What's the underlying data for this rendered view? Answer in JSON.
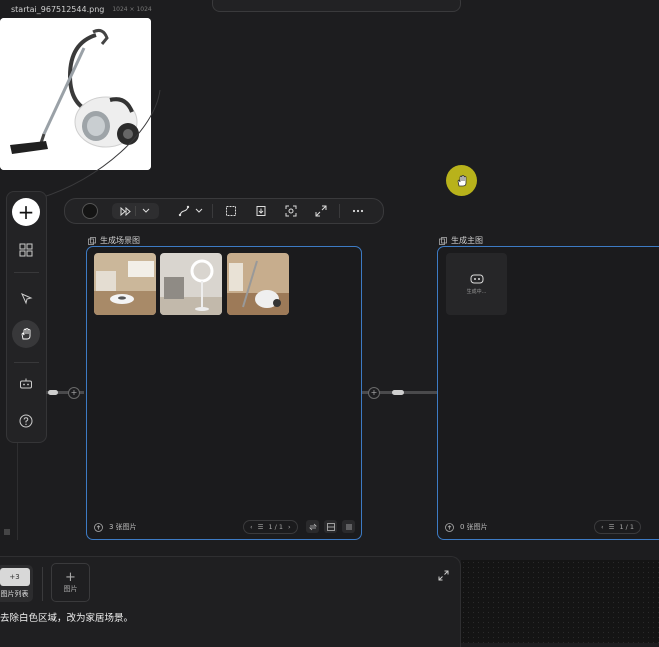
{
  "source_image": {
    "filename": "startai_967512544.png",
    "dimensions": "1024 × 1024"
  },
  "toolbar": {
    "icons": [
      "color-swatch-icon",
      "fast-forward-icon",
      "chevron-down-icon",
      "pen-path-icon",
      "chevron-down-icon",
      "frame-icon",
      "export-icon",
      "focus-icon",
      "expand-icon",
      "more-icon"
    ]
  },
  "sidebar": {
    "icons": [
      "plus-icon",
      "grid-icon",
      "pointer-icon",
      "hand-icon",
      "ai-bot-icon",
      "help-icon"
    ]
  },
  "nodes": [
    {
      "title": "生成场景图",
      "count_label": "3 张图片",
      "page": "1 / 1"
    },
    {
      "title": "生成主图",
      "count_label": "0 张图片",
      "page": "1 / 1",
      "generating_label": "生成中..."
    }
  ],
  "bottom": {
    "image_list_label": "图片列表",
    "image_list_badge": "+3",
    "add_image_label": "图片",
    "prompt": "去除白色区域，改为家居场景。"
  },
  "colors": {
    "accent_border": "#3d7bc4",
    "cursor": "#b8b21b",
    "background": "#1d1d1f"
  }
}
